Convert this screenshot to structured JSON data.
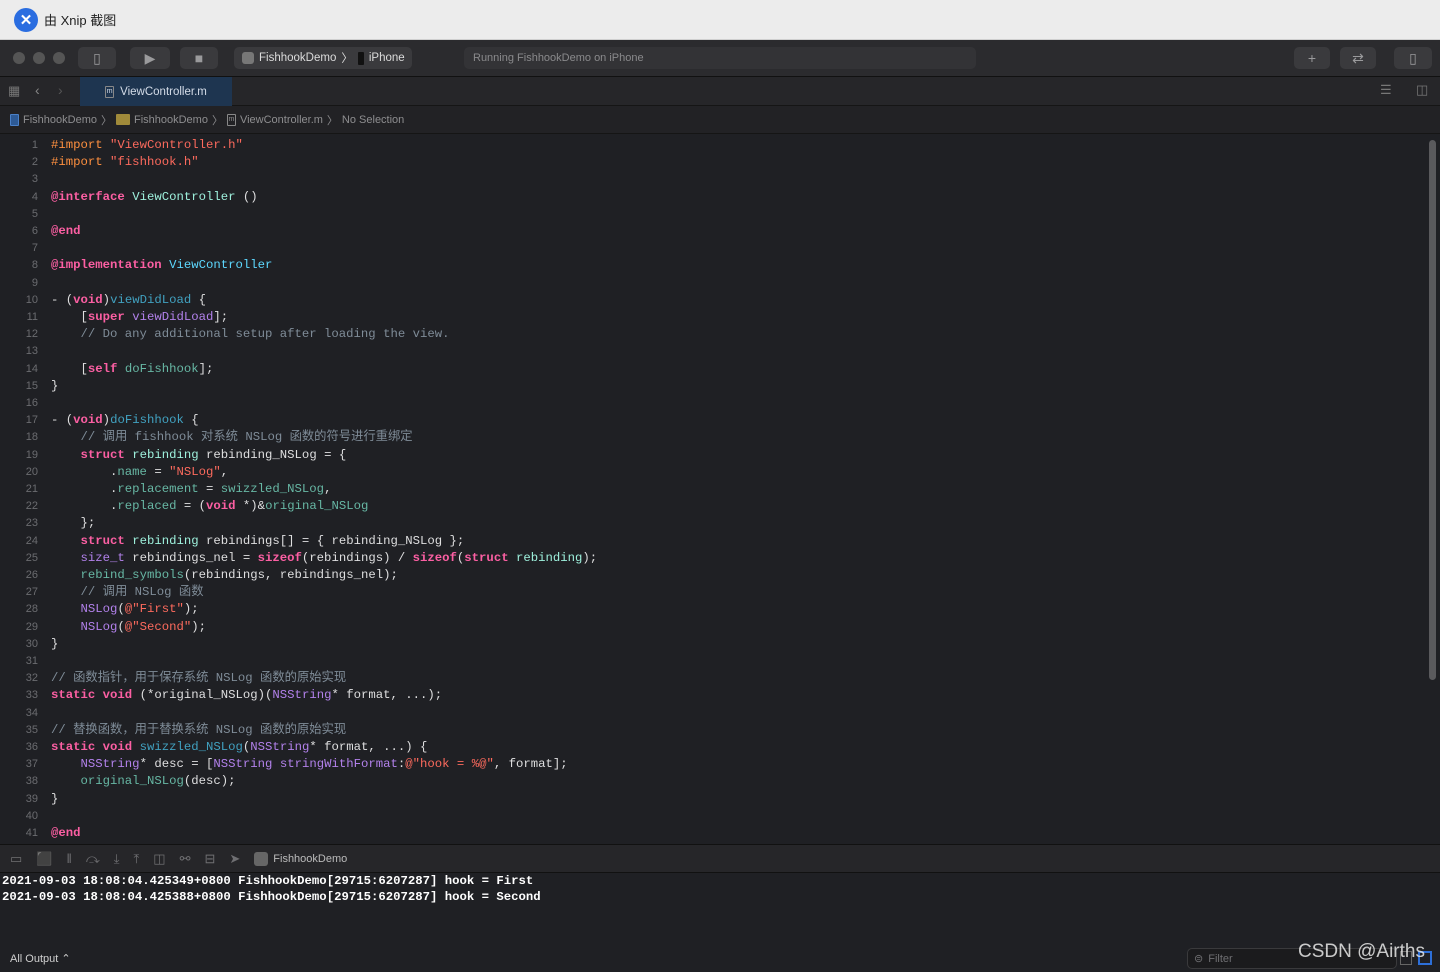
{
  "capture_bar": {
    "title": "由 Xnip 截图"
  },
  "toolbar": {
    "scheme": "FishhookDemo",
    "device": "iPhone",
    "status": "Running FishhookDemo on iPhone"
  },
  "tab": {
    "label": "ViewController.m"
  },
  "jump_bar": {
    "items": [
      "FishhookDemo",
      "FishhookDemo",
      "ViewController.m",
      "No Selection"
    ]
  },
  "colors": {
    "keyword": "#fc5fa3",
    "string": "#fc6a5d",
    "preprocessor": "#fd8f3f",
    "comment": "#7f8c98",
    "tab_selected": "#1e3550"
  },
  "code": [
    [
      [
        "#import ",
        "pp"
      ],
      [
        "\"ViewController.h\"",
        "str"
      ]
    ],
    [
      [
        "#import ",
        "pp"
      ],
      [
        "\"fishhook.h\"",
        "str"
      ]
    ],
    [],
    [
      [
        "@interface ",
        "kw"
      ],
      [
        "ViewController",
        "tdecl"
      ],
      [
        " ()",
        "plain"
      ]
    ],
    [],
    [
      [
        "@end",
        "kw"
      ]
    ],
    [],
    [
      [
        "@implementation ",
        "kw"
      ],
      [
        "ViewController",
        "cls"
      ]
    ],
    [],
    [
      [
        "- (",
        "plain"
      ],
      [
        "void",
        "kw"
      ],
      [
        ")",
        "plain"
      ],
      [
        "viewDidLoad",
        "decl"
      ],
      [
        " {",
        "plain"
      ]
    ],
    [
      [
        "    [",
        "plain"
      ],
      [
        "super",
        "kw"
      ],
      [
        " ",
        "plain"
      ],
      [
        "viewDidLoad",
        "api"
      ],
      [
        "];",
        "plain"
      ]
    ],
    [
      [
        "    // Do any additional setup after loading the view.",
        "cm"
      ]
    ],
    [],
    [
      [
        "    [",
        "plain"
      ],
      [
        "self",
        "kw"
      ],
      [
        " ",
        "plain"
      ],
      [
        "doFishhook",
        "proj"
      ],
      [
        "];",
        "plain"
      ]
    ],
    [
      [
        "}",
        "plain"
      ]
    ],
    [],
    [
      [
        "- (",
        "plain"
      ],
      [
        "void",
        "kw"
      ],
      [
        ")",
        "plain"
      ],
      [
        "doFishhook",
        "decl"
      ],
      [
        " {",
        "plain"
      ]
    ],
    [
      [
        "    // 调用 fishhook 对系统 NSLog 函数的符号进行重绑定",
        "cm"
      ]
    ],
    [
      [
        "    ",
        "plain"
      ],
      [
        "struct",
        "kw"
      ],
      [
        " ",
        "plain"
      ],
      [
        "rebinding",
        "ptype"
      ],
      [
        " rebinding_NSLog = {",
        "plain"
      ]
    ],
    [
      [
        "        .",
        "plain"
      ],
      [
        "name",
        "proj"
      ],
      [
        " = ",
        "plain"
      ],
      [
        "\"NSLog\"",
        "str"
      ],
      [
        ",",
        "plain"
      ]
    ],
    [
      [
        "        .",
        "plain"
      ],
      [
        "replacement",
        "proj"
      ],
      [
        " = ",
        "plain"
      ],
      [
        "swizzled_NSLog",
        "proj"
      ],
      [
        ",",
        "plain"
      ]
    ],
    [
      [
        "        .",
        "plain"
      ],
      [
        "replaced",
        "proj"
      ],
      [
        " = (",
        "plain"
      ],
      [
        "void",
        "kw"
      ],
      [
        " *)&",
        "plain"
      ],
      [
        "original_NSLog",
        "proj"
      ]
    ],
    [
      [
        "    };",
        "plain"
      ]
    ],
    [
      [
        "    ",
        "plain"
      ],
      [
        "struct",
        "kw"
      ],
      [
        " ",
        "plain"
      ],
      [
        "rebinding",
        "ptype"
      ],
      [
        " rebindings[] = { rebinding_NSLog };",
        "plain"
      ]
    ],
    [
      [
        "    ",
        "plain"
      ],
      [
        "size_t",
        "api"
      ],
      [
        " rebindings_nel = ",
        "plain"
      ],
      [
        "sizeof",
        "kw"
      ],
      [
        "(rebindings) / ",
        "plain"
      ],
      [
        "sizeof",
        "kw"
      ],
      [
        "(",
        "plain"
      ],
      [
        "struct",
        "kw"
      ],
      [
        " ",
        "plain"
      ],
      [
        "rebinding",
        "ptype"
      ],
      [
        ");",
        "plain"
      ]
    ],
    [
      [
        "    ",
        "plain"
      ],
      [
        "rebind_symbols",
        "proj"
      ],
      [
        "(rebindings, rebindings_nel);",
        "plain"
      ]
    ],
    [
      [
        "    // 调用 NSLog 函数",
        "cm"
      ]
    ],
    [
      [
        "    ",
        "plain"
      ],
      [
        "NSLog",
        "api"
      ],
      [
        "(",
        "plain"
      ],
      [
        "@\"First\"",
        "str"
      ],
      [
        ");",
        "plain"
      ]
    ],
    [
      [
        "    ",
        "plain"
      ],
      [
        "NSLog",
        "api"
      ],
      [
        "(",
        "plain"
      ],
      [
        "@\"Second\"",
        "str"
      ],
      [
        ");",
        "plain"
      ]
    ],
    [
      [
        "}",
        "plain"
      ]
    ],
    [],
    [
      [
        "// 函数指针，用于保存系统 NSLog 函数的原始实现",
        "cm"
      ]
    ],
    [
      [
        "static",
        "kw"
      ],
      [
        " ",
        "plain"
      ],
      [
        "void",
        "kw"
      ],
      [
        " (*original_NSLog)(",
        "plain"
      ],
      [
        "NSString",
        "api"
      ],
      [
        "* format, ...);",
        "plain"
      ]
    ],
    [],
    [
      [
        "// 替换函数，用于替换系统 NSLog 函数的原始实现",
        "cm"
      ]
    ],
    [
      [
        "static",
        "kw"
      ],
      [
        " ",
        "plain"
      ],
      [
        "void",
        "kw"
      ],
      [
        " ",
        "plain"
      ],
      [
        "swizzled_NSLog",
        "decl"
      ],
      [
        "(",
        "plain"
      ],
      [
        "NSString",
        "api"
      ],
      [
        "* format, ...) {",
        "plain"
      ]
    ],
    [
      [
        "    ",
        "plain"
      ],
      [
        "NSString",
        "api"
      ],
      [
        "* desc = [",
        "plain"
      ],
      [
        "NSString",
        "api"
      ],
      [
        " ",
        "plain"
      ],
      [
        "stringWithFormat",
        "api"
      ],
      [
        ":",
        "plain"
      ],
      [
        "@\"hook = %@\"",
        "str"
      ],
      [
        ", format];",
        "plain"
      ]
    ],
    [
      [
        "    ",
        "plain"
      ],
      [
        "original_NSLog",
        "proj"
      ],
      [
        "(desc);",
        "plain"
      ]
    ],
    [
      [
        "}",
        "plain"
      ]
    ],
    [],
    [
      [
        "@end",
        "kw"
      ]
    ]
  ],
  "debug_bar": {
    "process": "FishhookDemo"
  },
  "console": {
    "lines": [
      "2021-09-03 18:08:04.425349+0800 FishhookDemo[29715:6207287] hook = First",
      "2021-09-03 18:08:04.425388+0800 FishhookDemo[29715:6207287] hook = Second"
    ],
    "output_selector": "All Output ⌃",
    "filter_placeholder": "Filter"
  },
  "watermark": "CSDN @Airths"
}
